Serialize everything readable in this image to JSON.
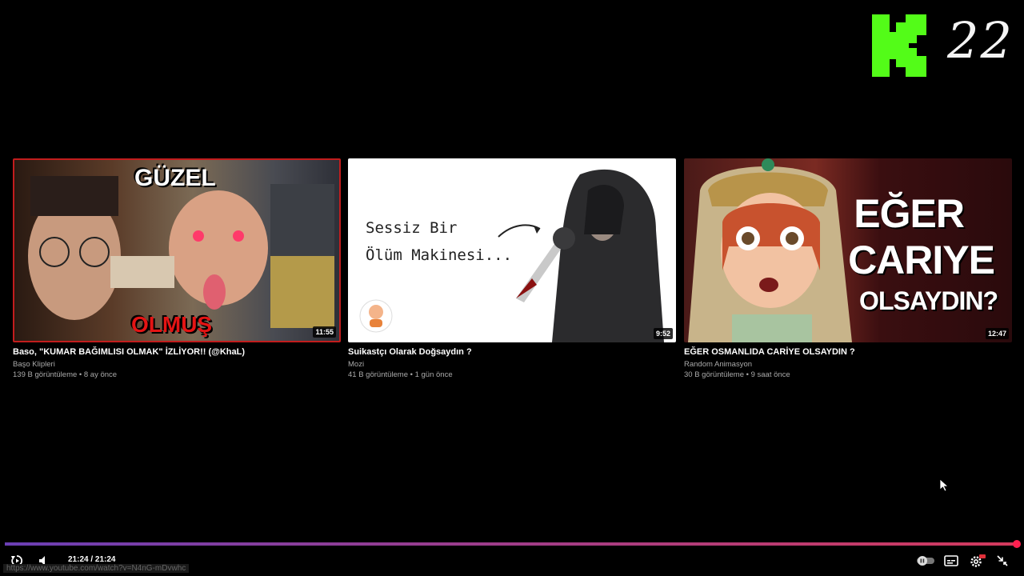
{
  "watermark": {
    "text": "22",
    "logo_color": "#53fc18"
  },
  "cards": [
    {
      "title": "Baso, \"KUMAR BAĞIMLISI OLMAK\" İZLİYOR!! (@KhaL)",
      "channel": "Başo Klipleri",
      "meta": "139 B görüntüleme • 8 ay önce",
      "duration": "11:55",
      "thumb_text_top": "GÜZEL",
      "thumb_text_bottom": "OLMUŞ"
    },
    {
      "title": "Suikastçı Olarak Doğsaydın ?",
      "channel": "Mozi",
      "meta": "41 B görüntüleme • 1 gün önce",
      "duration": "9:52",
      "thumb_line1": "Sessiz Bir",
      "thumb_line2": "Ölüm Makinesi..."
    },
    {
      "title": "EĞER OSMANLIDA CARİYE OLSAYDIN ?",
      "channel": "Random Animasyon",
      "meta": "30 B görüntüleme • 9 saat önce",
      "duration": "12:47",
      "thumb_line1": "EĞER",
      "thumb_line2": "CARIYE",
      "thumb_line3": "OLSAYDIN?"
    }
  ],
  "player": {
    "time": "21:24 / 21:24",
    "progress": 1.0,
    "status_url": "https://www.youtube.com/watch?v=N4nG-mDvwhc",
    "icons": [
      "replay-icon",
      "volume-icon",
      "autoplay-toggle",
      "subtitles-icon",
      "settings-icon",
      "exit-fullscreen-icon"
    ]
  }
}
